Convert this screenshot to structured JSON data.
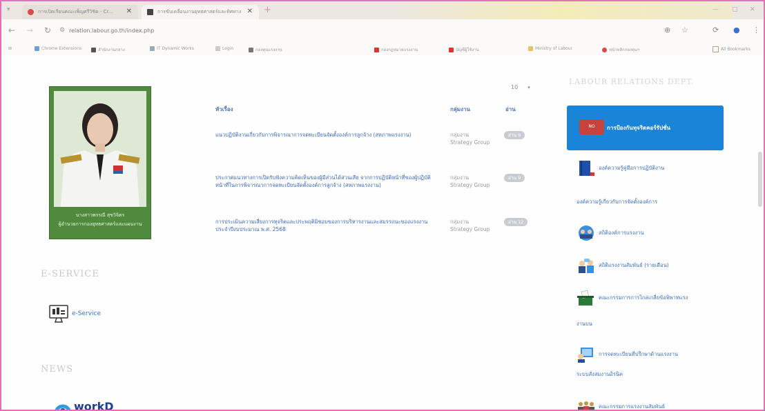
{
  "browser": {
    "tabs": [
      {
        "title": "การเปิดเรียนคณะเพ็ญศรีวิชิต - Cr..."
      },
      {
        "title": "การขับเคลื่อนงานยุทธศาสตร์และทิศทาง"
      }
    ],
    "url": "relation.labour.go.th/index.php",
    "bookmarks": [
      "Chrome Extensions",
      "สำนักงานกลาง",
      "IT Dynamic Works",
      "Login",
      "กองทุนแรงงาน",
      "กองกฎหมายแรงงาน",
      "บัญชีผู้ใช้งาน",
      "Ministry of Labour",
      "หน้าหลักกองทุนฯ",
      "All Bookmarks"
    ]
  },
  "profile": {
    "caption_line1": "นางสาวพรรณี สุขวิจิตร",
    "caption_line2": "ผู้อำนวยการกองยุทธศาสตร์และแผนงาน"
  },
  "sections": {
    "eservice_heading": "E-SERVICE",
    "eservice_label": "e-Service",
    "news_heading": "NEWS",
    "workd_label": "workD"
  },
  "table": {
    "page_size": "10",
    "headers": {
      "title": "หัวเรื่อง",
      "group": "กลุ่มงาน",
      "views": "อ่าน"
    },
    "rows": [
      {
        "title": "แนวปฏิบัติงานเกี่ยวกับการพิจารณาการจดทะเบียนจัดตั้งองค์การลูกจ้าง (สหภาพแรงงาน)",
        "group": "กลุ่มงาน Strategy Group",
        "views": "อ่าน 9"
      },
      {
        "title": "ประกาศแนวทางการเปิดรับฟังความคิดเห็นของผู้มีส่วนได้ส่วนเสีย จากการปฏิบัติหน้าที่ของผู้ปฏิบัติหน้าที่ในการพิจารณาการจดทะเบียนจัดตั้งองค์การลูกจ้าง (สหภาพแรงงาน)",
        "group": "กลุ่มงาน Strategy Group",
        "views": "อ่าน 9"
      },
      {
        "title": "การประเมินความเสี่ยงการทุจริตและประพฤติมิชอบของการบริหารงานและสมรรถนะของแรงงาน ประจำปีงบประมาณ พ.ศ. 2568",
        "group": "กลุ่มงาน Strategy Group",
        "views": "อ่าน 12"
      }
    ]
  },
  "right": {
    "heading": "LABOUR RELATIONS DEPT.",
    "highlight": "การป้องกันทุจริตคอร์รัปชั่น",
    "items": [
      {
        "label": "องค์ความรู้คู่มือการปฏิบัติงาน",
        "extra": "องค์ความรู้เกี่ยวกับการจัดตั้งองค์การ"
      },
      {
        "label": "สถิติองค์การแรงงาน",
        "extra": ""
      },
      {
        "label": "สถิติแรงงานสัมพันธ์ (รายเดือน)",
        "extra": ""
      },
      {
        "label": "คณะกรรมการการไกล่เกลี่ยข้อพิพาทแรง",
        "extra": "งานบน"
      },
      {
        "label": "การจดทะเบียนที่ปรึกษาด้านแรงงาน",
        "extra": "ระบบสั่งสมงานอิรนิค"
      },
      {
        "label": "คณะกรรมการแรงงานสัมพันธ์",
        "extra": ""
      }
    ]
  },
  "colors": {
    "accent": "#1a84d8",
    "link": "#3b6fc8",
    "frame": "#e272b8"
  }
}
